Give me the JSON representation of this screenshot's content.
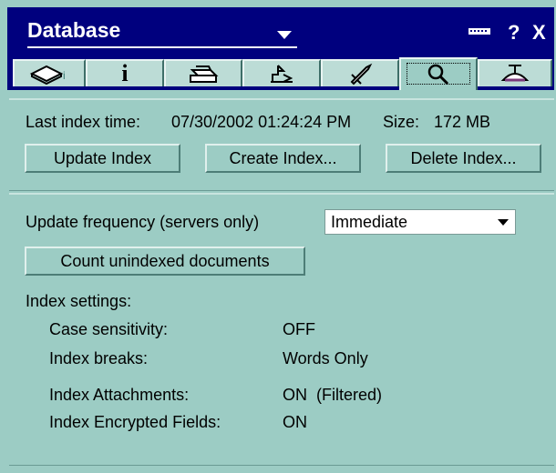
{
  "window": {
    "title": "Database"
  },
  "titlebar": {
    "help_label": "?",
    "close_label": "X"
  },
  "tabs": [
    {
      "name": "basics",
      "icon": "book-icon"
    },
    {
      "name": "info",
      "icon": "info-icon",
      "label": "i"
    },
    {
      "name": "print",
      "icon": "printer-icon"
    },
    {
      "name": "design",
      "icon": "design-icon"
    },
    {
      "name": "launch",
      "icon": "rocket-icon"
    },
    {
      "name": "full-text",
      "icon": "magnifier-icon",
      "active": true
    },
    {
      "name": "advanced",
      "icon": "propeller-hat-icon"
    }
  ],
  "index": {
    "last_index_label": "Last index time:",
    "last_index_value": "07/30/2002 01:24:24 PM",
    "size_label": "Size:",
    "size_value": "172 MB",
    "update_button": "Update Index",
    "create_button": "Create Index...",
    "delete_button": "Delete Index..."
  },
  "settings": {
    "frequency_label": "Update frequency (servers only)",
    "frequency_value": "Immediate",
    "count_button": "Count unindexed documents",
    "section_label": "Index settings:",
    "rows": [
      {
        "label": "Case sensitivity:",
        "value": "OFF"
      },
      {
        "label": "Index breaks:",
        "value": "Words Only"
      },
      {
        "label": "Index Attachments:",
        "value": "ON  (Filtered)"
      },
      {
        "label": "Index Encrypted Fields:",
        "value": "ON"
      }
    ]
  },
  "colors": {
    "titlebar": "#00007e",
    "panel": "#9cccc4",
    "tab": "#bcdcd6"
  }
}
